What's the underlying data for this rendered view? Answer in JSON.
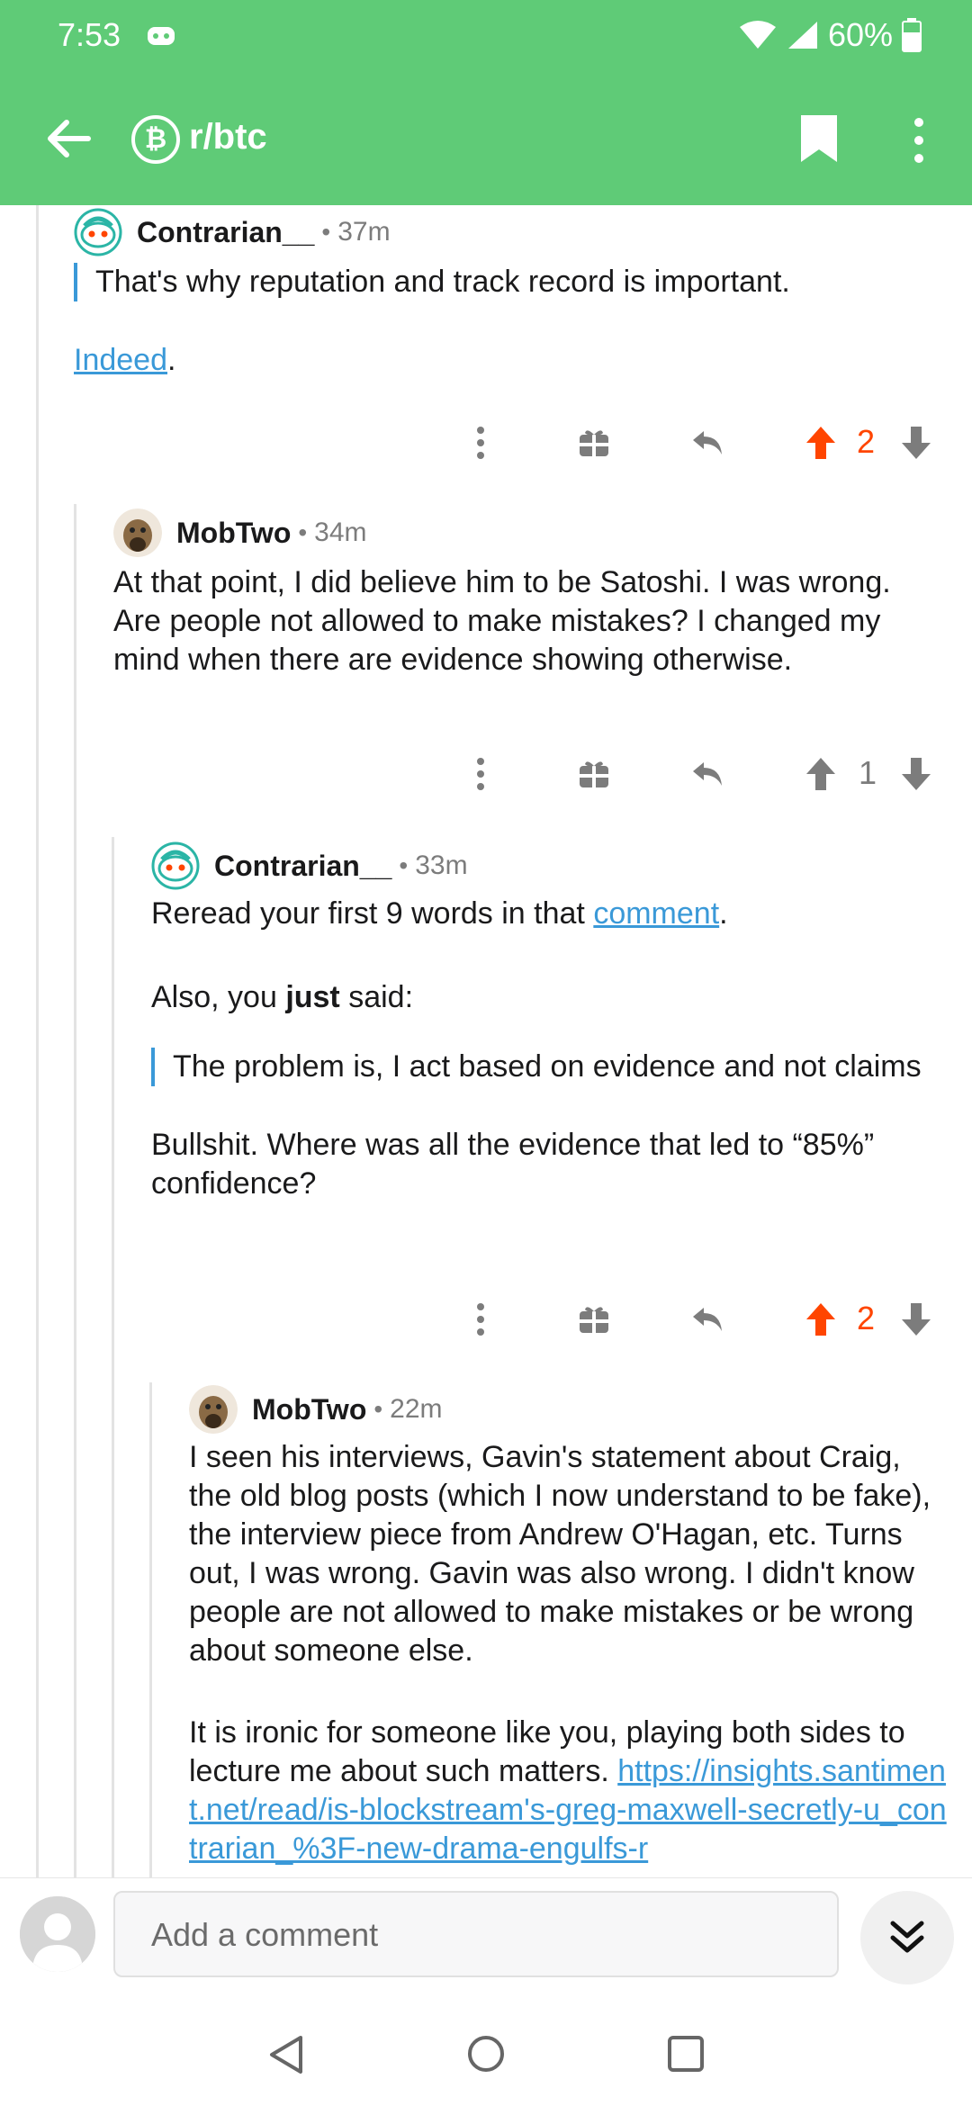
{
  "status_bar": {
    "time": "7:53",
    "battery": "60%"
  },
  "app_bar": {
    "subreddit": "r/btc",
    "subreddit_icon": "₿"
  },
  "comments": [
    {
      "author": "Contrarian__",
      "age": "37m",
      "quote": "That's why reputation and track record is important.",
      "link_text": "Indeed",
      "after_link": ".",
      "score": "2"
    },
    {
      "author": "MobTwo",
      "age": "34m",
      "text": "At that point, I did believe him to be Satoshi. I was wrong. Are people not allowed to make mistakes? I changed my mind when there are evidence showing otherwise.",
      "score": "1"
    },
    {
      "author": "Contrarian__",
      "age": "33m",
      "p1_before": "Reread your first 9 words in that ",
      "p1_link": "comment",
      "p1_after": ".",
      "p2_before": "Also, you ",
      "p2_bold": "just",
      "p2_after": " said:",
      "quote": "The problem is, I act based on evidence and not claims",
      "p3": "Bullshit. Where was all the evidence that led to “85%” confidence?",
      "score": "2"
    },
    {
      "author": "MobTwo",
      "age": "22m",
      "p1": "I seen his interviews, Gavin's statement about Craig, the old blog posts (which I now understand to be fake), the interview piece from Andrew O'Hagan, etc. Turns out, I was wrong. Gavin was also wrong. I didn't know people are not allowed to make mistakes or be wrong about someone else.",
      "p2_before": "It is ironic for someone like you, playing both sides to lecture me about such matters. ",
      "p2_link": "https://insights.santiment.net/read/is-blockstream's-greg-maxwell-secretly-u_contrarian_%3F-new-drama-engulfs-r"
    }
  ],
  "bottom_bar": {
    "placeholder": "Add a comment"
  },
  "colors": {
    "brand": "#5fcb77",
    "upvote": "#ff4500",
    "link": "#3a99d8"
  }
}
